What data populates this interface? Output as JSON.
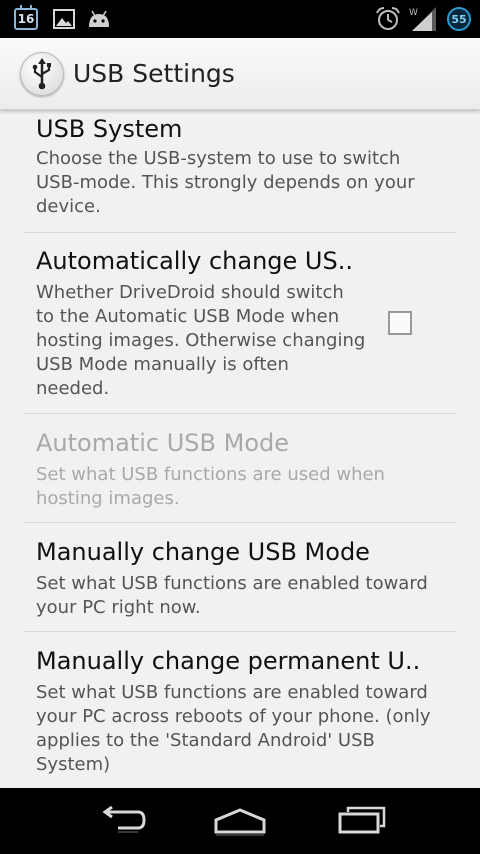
{
  "status_bar": {
    "calendar_day": "16",
    "battery_level": "55",
    "icons": [
      "calendar-icon",
      "image-icon",
      "android-icon",
      "alarm-icon",
      "wifi-signal-icon",
      "battery-icon"
    ]
  },
  "action_bar": {
    "title": "USB Settings",
    "icon": "usb-icon"
  },
  "preferences": [
    {
      "title": "USB System",
      "summary": "Choose the USB-system to use to switch USB-mode. This strongly depends on your device.",
      "enabled": true
    },
    {
      "title": "Automatically change US..",
      "summary": "Whether DriveDroid should switch to the Automatic USB Mode when hosting images. Otherwise changing USB Mode manually is often needed.",
      "enabled": true,
      "checked": false
    },
    {
      "title": "Automatic USB Mode",
      "summary": "Set what USB functions are used when hosting images.",
      "enabled": false
    },
    {
      "title": "Manually change USB Mode",
      "summary": "Set what USB functions are enabled toward your PC right now.",
      "enabled": true
    },
    {
      "title": "Manually change permanent U..",
      "summary": "Set what USB functions are enabled toward your PC across reboots of your phone. (only applies to the 'Standard Android' USB System)",
      "enabled": true
    }
  ],
  "nav_bar": {
    "buttons": [
      "back-icon",
      "home-icon",
      "recent-apps-icon"
    ]
  },
  "colors": {
    "background": "#f1f1f1",
    "status_bar": "#000000",
    "disabled_text": "#a9a9a9",
    "accent": "#2b9bd0"
  }
}
